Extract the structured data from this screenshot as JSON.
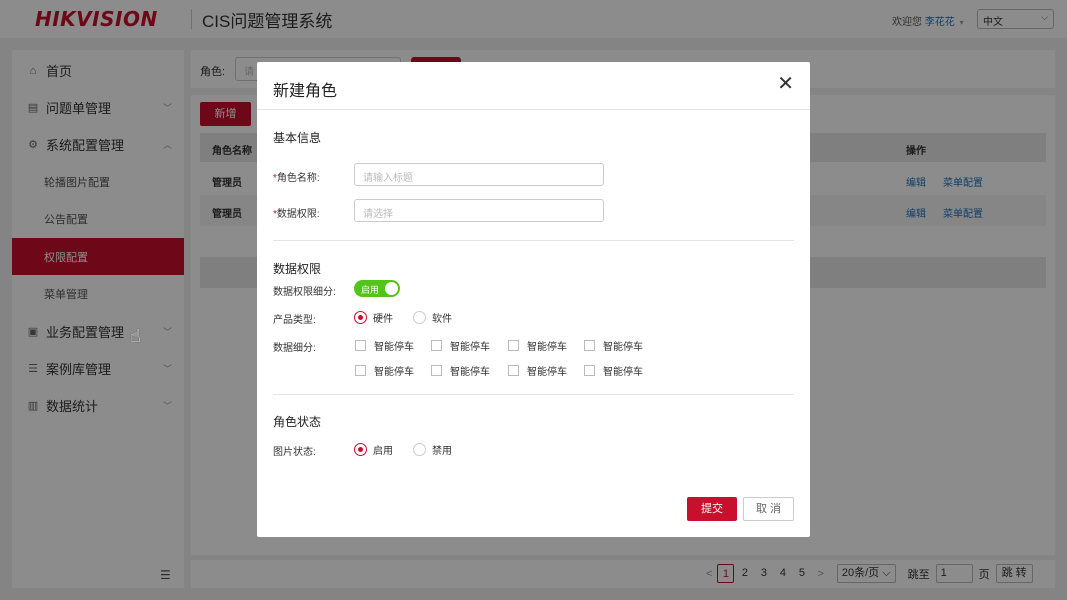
{
  "header": {
    "logo": "HIKVISION",
    "system_title": "CIS问题管理系统",
    "welcome": "欢迎您",
    "user_name": "李花花",
    "language": "中文"
  },
  "sidebar": {
    "items": [
      {
        "label": "首页",
        "icon": "home-icon"
      },
      {
        "label": "问题单管理",
        "icon": "document-icon"
      },
      {
        "label": "系统配置管理",
        "icon": "config-icon"
      },
      {
        "label": "业务配置管理",
        "icon": "briefcase-icon"
      },
      {
        "label": "案例库管理",
        "icon": "list-icon"
      },
      {
        "label": "数据统计",
        "icon": "chart-icon"
      }
    ],
    "sub_items": [
      {
        "label": "轮播图片配置"
      },
      {
        "label": "公告配置"
      },
      {
        "label": "权限配置"
      },
      {
        "label": "菜单管理"
      }
    ]
  },
  "filter": {
    "label": "角色:",
    "placeholder": "请"
  },
  "table": {
    "add_label": "新增",
    "columns": [
      "角色名称",
      "操作"
    ],
    "rows": [
      {
        "name": "管理员",
        "edit": "编辑",
        "menu": "菜单配置"
      },
      {
        "name": "管理员",
        "edit": "编辑",
        "menu": "菜单配置"
      }
    ]
  },
  "pagination": {
    "prev": "<",
    "pages": [
      "1",
      "2",
      "3",
      "4",
      "5"
    ],
    "current": "1",
    "next": ">",
    "page_size": "20条/页",
    "jump_label": "跳至",
    "jump_value": "1",
    "page_unit": "页",
    "go_label": "跳 转"
  },
  "modal": {
    "title": "新建角色",
    "section_basic": "基本信息",
    "role_name_label": "角色名称:",
    "role_name_placeholder": "请输入标题",
    "data_perm_label": "数据权限:",
    "data_perm_placeholder": "请选择",
    "section_data": "数据权限",
    "detail_label": "数据权限细分:",
    "switch_text": "启用",
    "switch_on": true,
    "product_type_label": "产品类型:",
    "product_types": [
      "硬件",
      "软件"
    ],
    "product_type_selected": "硬件",
    "data_detail_label": "数据细分:",
    "data_details": [
      "智能停车",
      "智能停车",
      "智能停车",
      "智能停车",
      "智能停车",
      "智能停车",
      "智能停车",
      "智能停车"
    ],
    "section_status": "角色状态",
    "image_status_label": "图片状态:",
    "image_status_options": [
      "启用",
      "禁用"
    ],
    "image_status_selected": "启用",
    "submit_label": "提交",
    "cancel_label": "取 消"
  },
  "colors": {
    "brand": "#c8102e",
    "link": "#1e73be",
    "switch_on": "#52c41a"
  }
}
